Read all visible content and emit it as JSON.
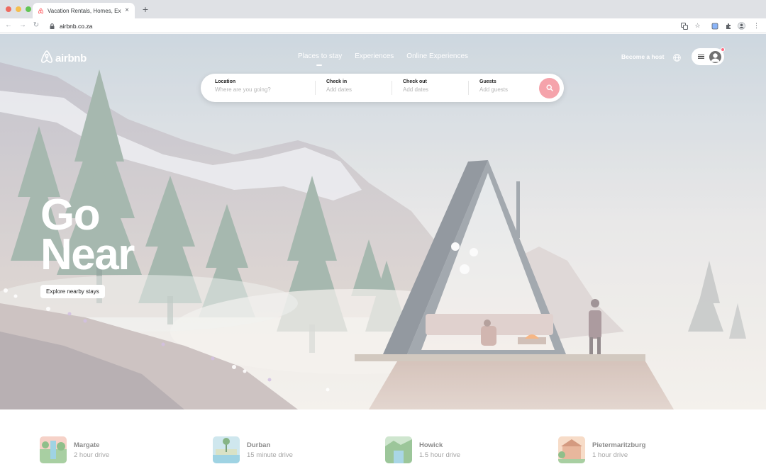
{
  "browser": {
    "tab_title": "Vacation Rentals, Homes, Experiences & Places - Airbnb",
    "tab_close": "×",
    "new_tab": "+",
    "url": "airbnb.co.za",
    "traffic_light_colors": [
      "#ee6a5f",
      "#f5be4f",
      "#62c554"
    ]
  },
  "header": {
    "logo_text": "airbnb",
    "tabs": [
      {
        "label": "Places to stay",
        "active": true
      },
      {
        "label": "Experiences",
        "active": false
      },
      {
        "label": "Online Experiences",
        "active": false
      }
    ],
    "become_host": "Become a host",
    "globe_icon": "globe-icon",
    "menu_icon": "hamburger-icon",
    "avatar_icon": "user-avatar-icon",
    "notification_color": "#ff6b81"
  },
  "search": {
    "location": {
      "label": "Location",
      "placeholder": "Where are you going?"
    },
    "check_in": {
      "label": "Check in",
      "placeholder": "Add dates"
    },
    "check_out": {
      "label": "Check out",
      "placeholder": "Add dates"
    },
    "guests": {
      "label": "Guests",
      "placeholder": "Add guests"
    },
    "button_icon": "search-icon",
    "button_color": "#f5a3ab"
  },
  "hero": {
    "headline_line1": "Go",
    "headline_line2": "Near",
    "cta": "Explore nearby stays"
  },
  "nearby": [
    {
      "name": "Margate",
      "distance": "2 hour drive"
    },
    {
      "name": "Durban",
      "distance": "15 minute drive"
    },
    {
      "name": "Howick",
      "distance": "1.5 hour drive"
    },
    {
      "name": "Pietermaritzburg",
      "distance": "1 hour drive"
    }
  ]
}
